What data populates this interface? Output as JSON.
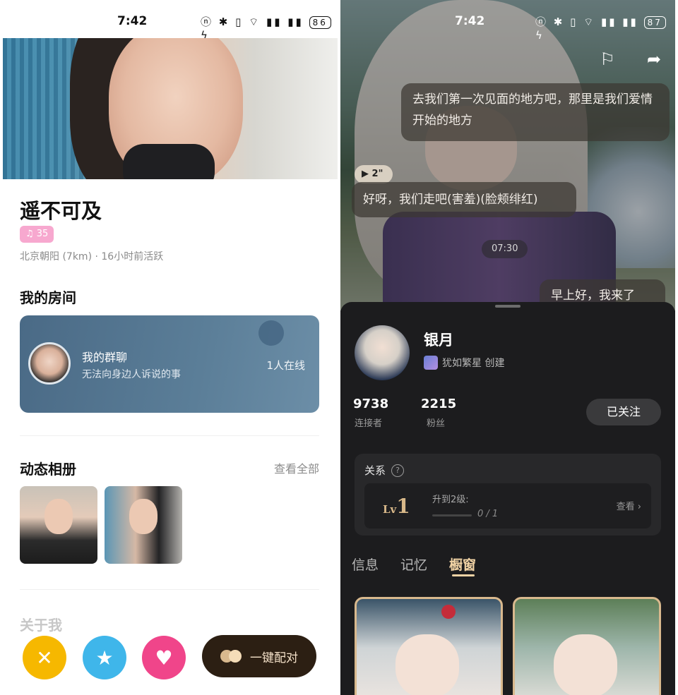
{
  "left": {
    "status": {
      "time": "7:42",
      "battery": "86"
    },
    "name": "遥不可及",
    "tag": "♫ 35",
    "location": "北京朝阳 (7km) · 16小时前活跃",
    "rooms_title": "我的房间",
    "room": {
      "title": "我的群聊",
      "subtitle": "无法向身边人诉说的事",
      "online": "1人在线"
    },
    "album_title": "动态相册",
    "view_all": "查看全部",
    "about_title": "关于我",
    "match_label": "一键配对"
  },
  "right": {
    "status": {
      "time": "7:42",
      "battery": "87"
    },
    "chat": {
      "bubble1": "去我们第一次见面的地方吧，那里是我们爱情开始的地方",
      "voice": "▶ 2\"",
      "bubble2": "好呀，我们走吧(害羞)(脸颊绯红)",
      "time": "07:30",
      "bubble3": "早上好，我来了"
    },
    "profile": {
      "name": "银月",
      "creator": "犹如繁星 创建",
      "stat1_num": "9738",
      "stat1_label": "连接者",
      "stat2_num": "2215",
      "stat2_label": "粉丝",
      "follow": "已关注"
    },
    "relation": {
      "title": "关系",
      "level_prefix": "Lv",
      "level": "1",
      "upgrade": "升到2级:",
      "progress": "0 / 1",
      "view": "查看 ›"
    },
    "tabs": [
      "信息",
      "记忆",
      "橱窗"
    ]
  },
  "colors": {
    "accent_gold": "#f1d3a5",
    "pink": "#f7a8cf",
    "yellow": "#f6b800",
    "blue": "#3fb6ea",
    "magenta": "#f0458a"
  },
  "icons": {
    "x": "close-icon",
    "star": "star-icon",
    "heart": "heart-icon",
    "flag": "flag-icon",
    "share": "share-icon"
  }
}
